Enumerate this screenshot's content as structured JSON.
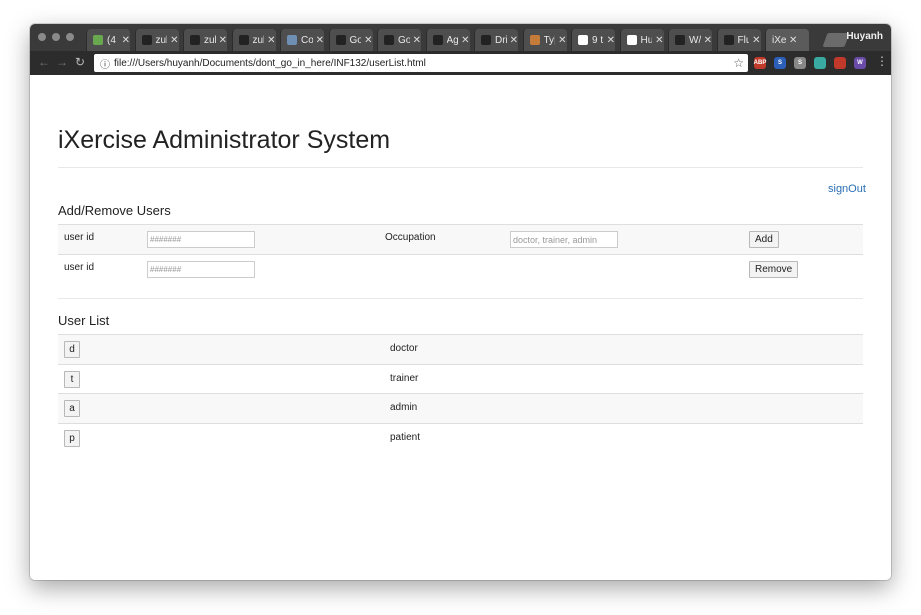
{
  "browser": {
    "tabs": [
      {
        "label": "(4",
        "icon": "avatar-icon",
        "color": "#6aa84f"
      },
      {
        "label": "zul",
        "icon": "github-icon",
        "color": "#222222"
      },
      {
        "label": "zul",
        "icon": "github-icon",
        "color": "#222222"
      },
      {
        "label": "zul",
        "icon": "github-icon",
        "color": "#222222"
      },
      {
        "label": "Co",
        "icon": "grid-icon",
        "color": "#6e8fb3"
      },
      {
        "label": "Go",
        "icon": "github-icon",
        "color": "#222222"
      },
      {
        "label": "Go",
        "icon": "github-icon",
        "color": "#222222"
      },
      {
        "label": "Ag",
        "icon": "github-icon",
        "color": "#222222"
      },
      {
        "label": "Dri",
        "icon": "github-icon",
        "color": "#222222"
      },
      {
        "label": "Ty|",
        "icon": "code-icon",
        "color": "#c57b3a"
      },
      {
        "label": "9 t",
        "icon": "square-icon",
        "color": "#ffffff"
      },
      {
        "label": "Hu",
        "icon": "ws-icon",
        "color": "#ffffff"
      },
      {
        "label": "W/",
        "icon": "github-icon",
        "color": "#222222"
      },
      {
        "label": "Flu",
        "icon": "github-icon",
        "color": "#222222"
      },
      {
        "label": "iXe",
        "icon": "",
        "color": "#5b5b5b"
      }
    ],
    "profile_name": "Huyanh",
    "url": "file:///Users/huyanh/Documents/dont_go_in_here/INF132/userList.html",
    "extensions": [
      {
        "label": "ABP",
        "color": "#c0392b"
      },
      {
        "label": "S",
        "color": "#2c5fb8"
      },
      {
        "label": "S",
        "color": "#888888"
      },
      {
        "label": "",
        "color": "#3aa9a1"
      },
      {
        "label": "",
        "color": "#c0392b"
      },
      {
        "label": "W",
        "color": "#6a4ba8"
      }
    ]
  },
  "page": {
    "title": "iXercise Administrator System",
    "signout": "signOut",
    "add_remove": {
      "heading": "Add/Remove Users",
      "add_row": {
        "user_id_label": "user id",
        "user_id_placeholder": "#######",
        "occupation_label": "Occupation",
        "occupation_placeholder": "doctor, trainer, admin",
        "add_button": "Add"
      },
      "remove_row": {
        "user_id_label": "user id",
        "user_id_placeholder": "#######",
        "remove_button": "Remove"
      }
    },
    "user_list": {
      "heading": "User List",
      "rows": [
        {
          "id": "d",
          "occupation": "doctor"
        },
        {
          "id": "t",
          "occupation": "trainer"
        },
        {
          "id": "a",
          "occupation": "admin"
        },
        {
          "id": "p",
          "occupation": "patient"
        }
      ]
    }
  }
}
